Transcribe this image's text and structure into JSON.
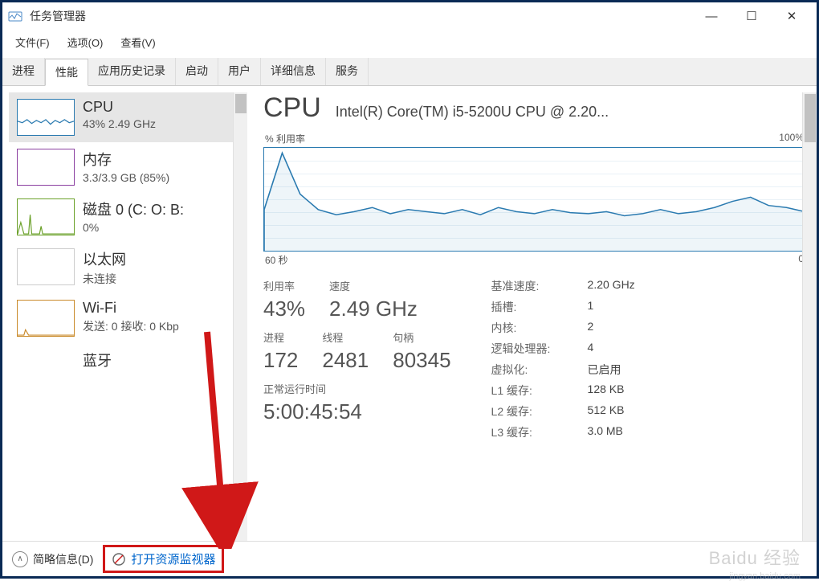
{
  "window": {
    "title": "任务管理器"
  },
  "menubar": [
    "文件(F)",
    "选项(O)",
    "查看(V)"
  ],
  "tabs": [
    "进程",
    "性能",
    "应用历史记录",
    "启动",
    "用户",
    "详细信息",
    "服务"
  ],
  "activeTab": "性能",
  "sidebar": {
    "items": [
      {
        "name": "CPU",
        "value": "43% 2.49 GHz",
        "color": "#2a7ab0",
        "selected": true
      },
      {
        "name": "内存",
        "value": "3.3/3.9 GB (85%)",
        "color": "#8b3fa0",
        "selected": false
      },
      {
        "name": "磁盘 0 (C: O: B:",
        "value": "0%",
        "color": "#6aa028",
        "selected": false
      },
      {
        "name": "以太网",
        "value": "未连接",
        "color": "#bfbfbf",
        "selected": false
      },
      {
        "name": "Wi-Fi",
        "value": "发送: 0 接收: 0 Kbp",
        "color": "#c98a2a",
        "selected": false
      },
      {
        "name": "蓝牙",
        "value": "",
        "color": "#2a7ab0",
        "selected": false
      }
    ]
  },
  "main": {
    "title": "CPU",
    "subtitle": "Intel(R) Core(TM) i5-5200U CPU @ 2.20...",
    "chartTopLeft": "% 利用率",
    "chartTopRight": "100%",
    "chartBottomLeft": "60 秒",
    "chartBottomRight": "0",
    "stats": {
      "util_label": "利用率",
      "util_value": "43%",
      "speed_label": "速度",
      "speed_value": "2.49 GHz",
      "proc_label": "进程",
      "proc_value": "172",
      "thread_label": "线程",
      "thread_value": "2481",
      "handle_label": "句柄",
      "handle_value": "80345",
      "uptime_label": "正常运行时间",
      "uptime_value": "5:00:45:54"
    },
    "specs": {
      "base_label": "基准速度:",
      "base_value": "2.20 GHz",
      "socket_label": "插槽:",
      "socket_value": "1",
      "core_label": "内核:",
      "core_value": "2",
      "logical_label": "逻辑处理器:",
      "logical_value": "4",
      "virt_label": "虚拟化:",
      "virt_value": "已启用",
      "l1_label": "L1 缓存:",
      "l1_value": "128 KB",
      "l2_label": "L2 缓存:",
      "l2_value": "512 KB",
      "l3_label": "L3 缓存:",
      "l3_value": "3.0 MB"
    }
  },
  "footer": {
    "collapse": "简略信息(D)",
    "resmon": "打开资源监视器"
  },
  "chart_data": {
    "type": "line",
    "title": "% 利用率",
    "xlabel": "秒",
    "ylabel": "利用率 %",
    "x_range": [
      60,
      0
    ],
    "ylim": [
      0,
      100
    ],
    "x": [
      60,
      58,
      56,
      54,
      52,
      50,
      48,
      46,
      44,
      42,
      40,
      38,
      36,
      34,
      32,
      30,
      28,
      26,
      24,
      22,
      20,
      18,
      16,
      14,
      12,
      10,
      8,
      6,
      4,
      2,
      0
    ],
    "values": [
      40,
      95,
      55,
      40,
      35,
      38,
      42,
      36,
      40,
      38,
      36,
      40,
      35,
      42,
      38,
      36,
      40,
      37,
      36,
      38,
      34,
      36,
      40,
      36,
      38,
      42,
      48,
      52,
      44,
      42,
      38
    ]
  },
  "watermark": {
    "brand": "Baidu 经验",
    "sub": "jingyan.baidu.com"
  }
}
